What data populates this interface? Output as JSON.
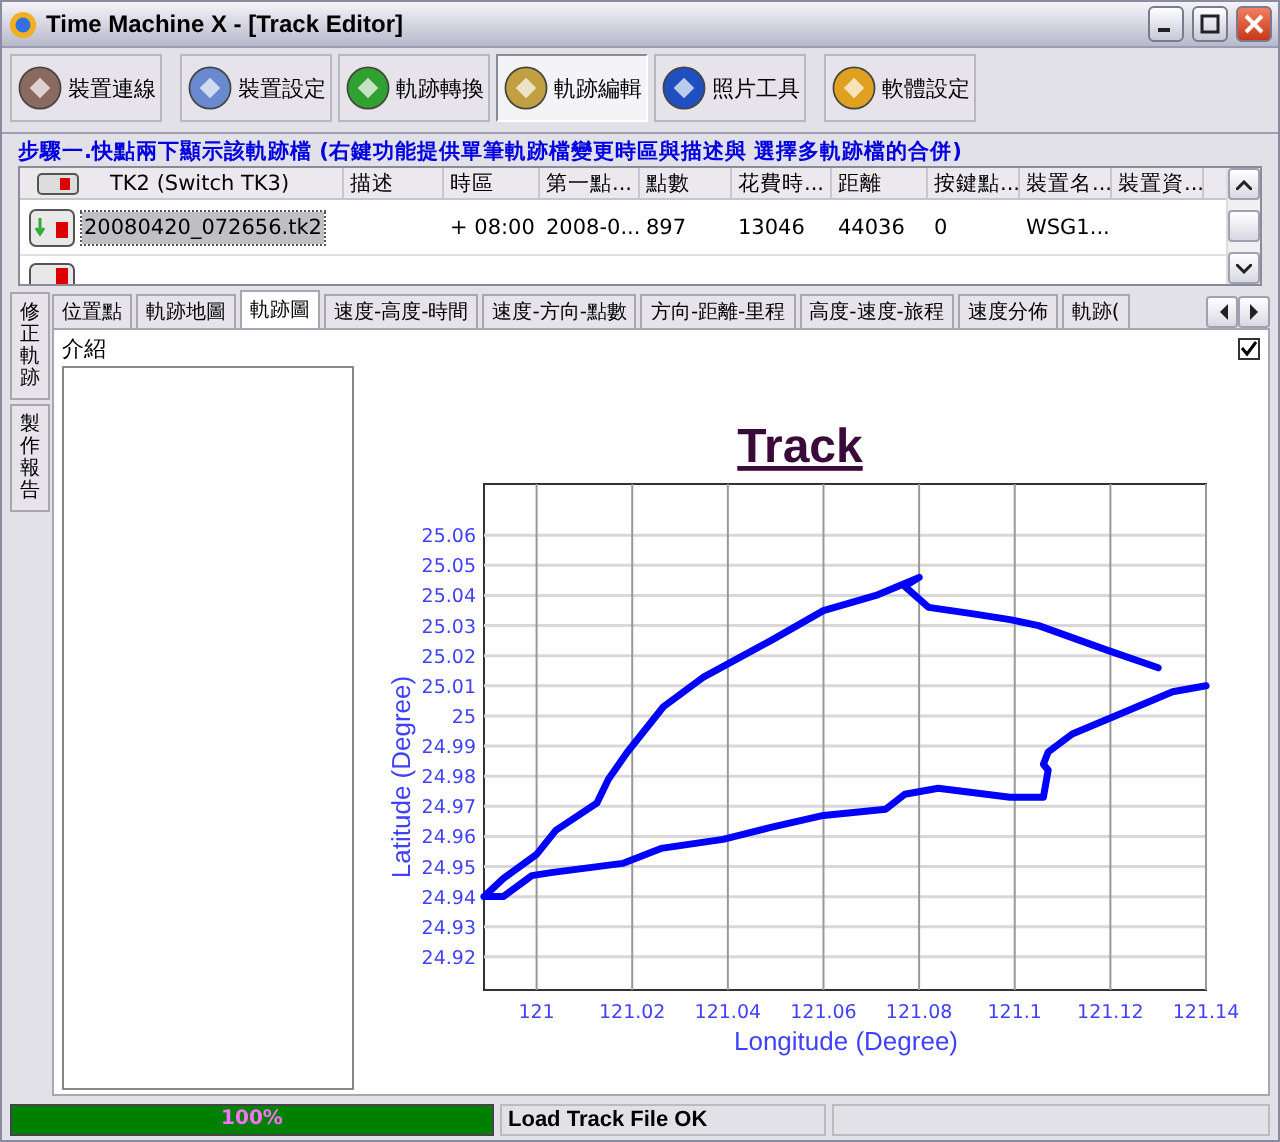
{
  "window": {
    "title": "Time Machine X - [Track Editor]"
  },
  "toolbar": [
    {
      "label": "裝置連線",
      "selected": false,
      "color": "#8a6a60"
    },
    {
      "label": "裝置設定",
      "selected": false,
      "color": "#6a8ad0"
    },
    {
      "label": "軌跡轉換",
      "selected": false,
      "color": "#30a030"
    },
    {
      "label": "軌跡編輯",
      "selected": true,
      "color": "#c0a040"
    },
    {
      "label": "照片工具",
      "selected": false,
      "color": "#2050c0"
    },
    {
      "label": "軟體設定",
      "selected": false,
      "color": "#e0a020"
    }
  ],
  "track_group": {
    "title": "步驟一.快點兩下顯示該軌跡檔 (右鍵功能提供單筆軌跡檔變更時區與描述與 選擇多軌跡檔的合併)",
    "columns": [
      "TK2 (Switch TK3)",
      "描述",
      "時區",
      "第一點...",
      "點數",
      "花費時...",
      "距離",
      "按鍵點...",
      "裝置名...",
      "裝置資..."
    ],
    "rows": [
      {
        "selected": true,
        "cells": [
          "20080420_072656.tk2",
          "",
          "+ 08:00",
          "2008-0...",
          "897",
          "13046",
          "44036",
          "0",
          "WSG1...",
          ""
        ]
      }
    ]
  },
  "side_tabs": [
    {
      "label": "修正軌跡",
      "selected": false
    },
    {
      "label": "製作報告",
      "selected": false
    }
  ],
  "tabs": [
    {
      "label": "位置點",
      "selected": false
    },
    {
      "label": "軌跡地圖",
      "selected": false
    },
    {
      "label": "軌跡圖",
      "selected": true
    },
    {
      "label": "速度-高度-時間",
      "selected": false
    },
    {
      "label": "速度-方向-點數",
      "selected": false
    },
    {
      "label": "方向-距離-里程",
      "selected": false
    },
    {
      "label": "高度-速度-旅程",
      "selected": false
    },
    {
      "label": "速度分佈",
      "selected": false
    },
    {
      "label": "軌跡(",
      "selected": false
    }
  ],
  "panel": {
    "label": "介紹",
    "checked": true
  },
  "chart_data": {
    "type": "line",
    "title": "Track",
    "xlabel": "Longitude (Degree)",
    "ylabel": "Latitude (Degree)",
    "grid": true,
    "xlim": [
      120.989,
      121.14
    ],
    "ylim": [
      24.909,
      25.077
    ],
    "xticks": [
      121,
      121.02,
      121.04,
      121.06,
      121.08,
      121.1,
      121.12,
      121.14
    ],
    "yticks": [
      24.92,
      24.93,
      24.94,
      24.95,
      24.96,
      24.97,
      24.98,
      24.99,
      25,
      25.01,
      25.02,
      25.03,
      25.04,
      25.05,
      25.06
    ],
    "x": [
      120.989,
      120.993,
      121.0,
      121.004,
      121.0126,
      121.015,
      121.019,
      121.0265,
      121.035,
      121.049,
      121.06,
      121.071,
      121.077,
      121.08,
      121.077,
      121.082,
      121.091,
      121.099,
      121.105,
      121.119,
      121.13,
      121.135,
      121.14,
      121.133,
      121.121,
      121.112,
      121.107,
      121.106,
      121.107,
      121.106,
      121.099,
      121.084,
      121.077,
      121.073,
      121.06,
      121.049,
      121.039,
      121.026,
      121.018,
      121.003,
      120.999,
      120.993,
      120.989
    ],
    "series": [
      {
        "color": "#0000ff",
        "values": [
          24.94,
          24.946,
          24.954,
          24.962,
          24.971,
          24.979,
          24.988,
          25.003,
          25.013,
          25.025,
          25.035,
          25.04,
          25.044,
          25.046,
          25.043,
          25.036,
          25.034,
          25.032,
          25.03,
          25.022,
          25.016,
          null,
          25.01,
          25.008,
          25.0,
          24.994,
          24.988,
          24.984,
          24.982,
          24.973,
          24.973,
          24.976,
          24.974,
          24.969,
          24.967,
          24.963,
          24.959,
          24.956,
          24.951,
          24.948,
          24.947,
          24.94,
          24.94
        ]
      }
    ]
  },
  "status_bar": {
    "progress": {
      "level": 1,
      "text": "100%"
    },
    "message": "Load Track File OK"
  }
}
